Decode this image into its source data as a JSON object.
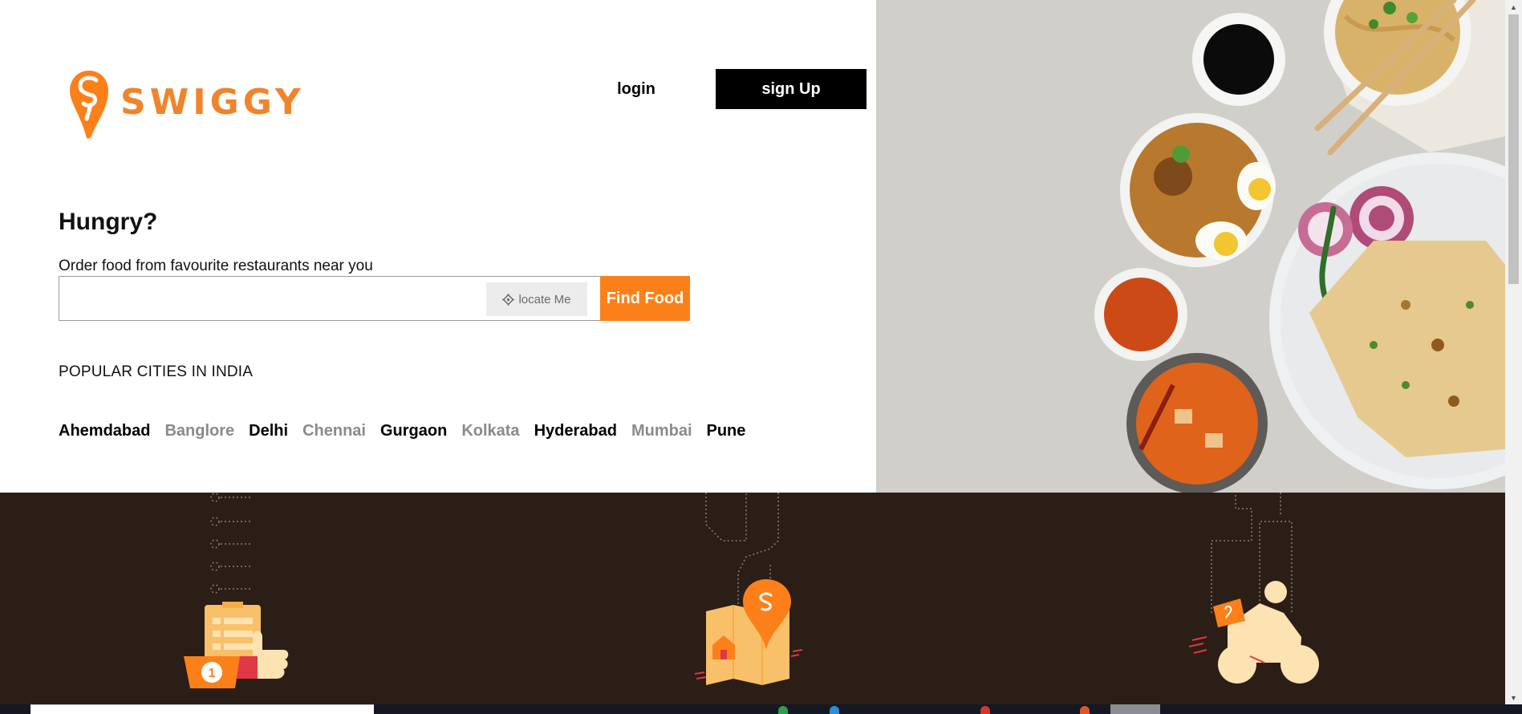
{
  "brand": {
    "name": "SWIGGY",
    "color": "#fc8019"
  },
  "header": {
    "login_label": "login",
    "signup_label": "sign Up"
  },
  "hero": {
    "title": "Hungry?",
    "subtitle": "Order food from favourite restaurants near you",
    "search": {
      "value": "",
      "placeholder": ""
    },
    "locate_label": "locate Me",
    "find_label": "Find Food"
  },
  "cities": {
    "title": "POPULAR CITIES IN INDIA",
    "items": [
      "Ahemdabad",
      "Banglore",
      "Delhi",
      "Chennai",
      "Gurgaon",
      "Kolkata",
      "Hyderabad",
      "Mumbai",
      "Pune"
    ]
  },
  "features": [
    {
      "icon": "order-checklist-thumbs-up-icon"
    },
    {
      "icon": "map-location-pin-icon"
    },
    {
      "icon": "delivery-scooter-icon"
    }
  ],
  "colors": {
    "accent": "#fc8019",
    "band": "#2b1e16",
    "text": "#000000",
    "muted": "#8a8a8a"
  }
}
